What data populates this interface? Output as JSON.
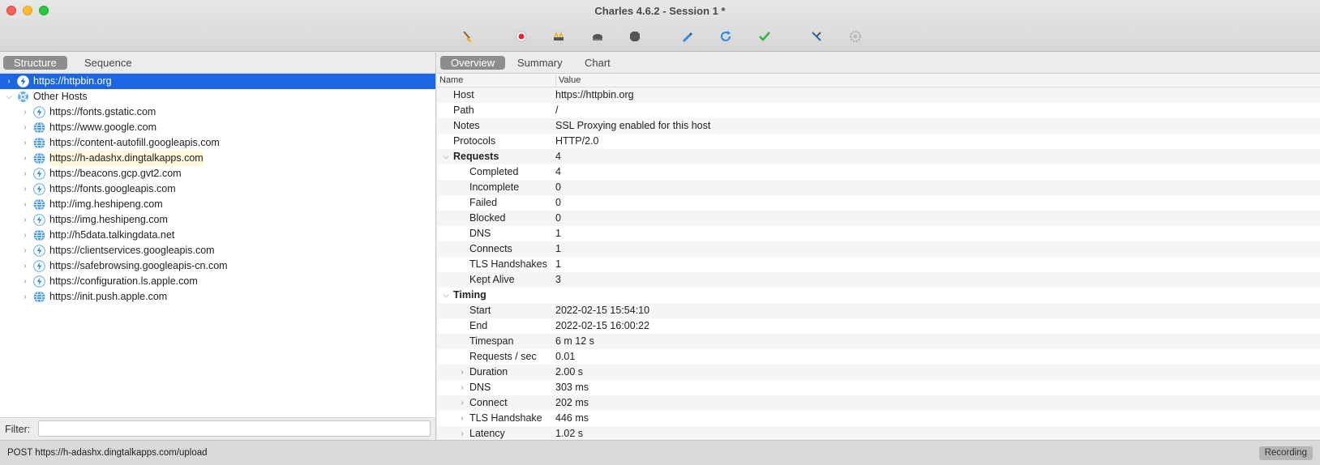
{
  "window": {
    "title": "Charles 4.6.2 - Session 1 *"
  },
  "toolbar": {
    "icons": [
      "broom-icon",
      "record-icon",
      "throttle-icon",
      "turtle-icon",
      "stop-breakpoint-icon",
      "compose-icon",
      "repeat-icon",
      "validate-icon",
      "tools-icon",
      "settings-icon"
    ]
  },
  "left_tabs": [
    {
      "label": "Structure",
      "active": true
    },
    {
      "label": "Sequence",
      "active": false
    }
  ],
  "tree": [
    {
      "label": "https://httpbin.org",
      "level": 0,
      "icon": "ssl-lightning-icon",
      "selected": true,
      "expanded": false
    },
    {
      "label": "Other Hosts",
      "level": 0,
      "icon": "hosts-gear-icon",
      "expanded": true
    },
    {
      "label": "https://fonts.gstatic.com",
      "level": 1,
      "icon": "ssl-lightning-icon"
    },
    {
      "label": "https://www.google.com",
      "level": 1,
      "icon": "globe-icon"
    },
    {
      "label": "https://content-autofill.googleapis.com",
      "level": 1,
      "icon": "globe-icon"
    },
    {
      "label": "https://h-adashx.dingtalkapps.com",
      "level": 1,
      "icon": "globe-icon",
      "highlighted": true
    },
    {
      "label": "https://beacons.gcp.gvt2.com",
      "level": 1,
      "icon": "ssl-lightning-icon"
    },
    {
      "label": "https://fonts.googleapis.com",
      "level": 1,
      "icon": "ssl-lightning-icon"
    },
    {
      "label": "http://img.heshipeng.com",
      "level": 1,
      "icon": "globe-icon"
    },
    {
      "label": "https://img.heshipeng.com",
      "level": 1,
      "icon": "ssl-lightning-icon"
    },
    {
      "label": "http://h5data.talkingdata.net",
      "level": 1,
      "icon": "globe-icon"
    },
    {
      "label": "https://clientservices.googleapis.com",
      "level": 1,
      "icon": "ssl-lightning-icon"
    },
    {
      "label": "https://safebrowsing.googleapis-cn.com",
      "level": 1,
      "icon": "ssl-lightning-icon"
    },
    {
      "label": "https://configuration.ls.apple.com",
      "level": 1,
      "icon": "ssl-lightning-icon"
    },
    {
      "label": "https://init.push.apple.com",
      "level": 1,
      "icon": "globe-icon"
    }
  ],
  "filter": {
    "label": "Filter:",
    "value": ""
  },
  "right_tabs": [
    {
      "label": "Overview",
      "active": true
    },
    {
      "label": "Summary",
      "active": false
    },
    {
      "label": "Chart",
      "active": false
    }
  ],
  "columns": {
    "name": "Name",
    "value": "Value"
  },
  "overview": [
    {
      "name": "Host",
      "value": "https://httpbin.org",
      "level": 0
    },
    {
      "name": "Path",
      "value": "/",
      "level": 0
    },
    {
      "name": "Notes",
      "value": "SSL Proxying enabled for this host",
      "level": 0
    },
    {
      "name": "Protocols",
      "value": "HTTP/2.0",
      "level": 0
    },
    {
      "name": "Requests",
      "value": "4",
      "level": 0,
      "group": true,
      "expanded": true
    },
    {
      "name": "Completed",
      "value": "4",
      "level": 1
    },
    {
      "name": "Incomplete",
      "value": "0",
      "level": 1
    },
    {
      "name": "Failed",
      "value": "0",
      "level": 1
    },
    {
      "name": "Blocked",
      "value": "0",
      "level": 1
    },
    {
      "name": "DNS",
      "value": "1",
      "level": 1
    },
    {
      "name": "Connects",
      "value": "1",
      "level": 1
    },
    {
      "name": "TLS Handshakes",
      "value": "1",
      "level": 1
    },
    {
      "name": "Kept Alive",
      "value": "3",
      "level": 1
    },
    {
      "name": "Timing",
      "value": "",
      "level": 0,
      "group": true,
      "expanded": true
    },
    {
      "name": "Start",
      "value": "2022-02-15 15:54:10",
      "level": 1
    },
    {
      "name": "End",
      "value": "2022-02-15 16:00:22",
      "level": 1
    },
    {
      "name": "Timespan",
      "value": "6 m 12 s",
      "level": 1
    },
    {
      "name": "Requests / sec",
      "value": "0.01",
      "level": 1
    },
    {
      "name": "Duration",
      "value": "2.00 s",
      "level": 1,
      "collapsed": true
    },
    {
      "name": "DNS",
      "value": "303 ms",
      "level": 1,
      "collapsed": true
    },
    {
      "name": "Connect",
      "value": "202 ms",
      "level": 1,
      "collapsed": true
    },
    {
      "name": "TLS Handshake",
      "value": "446 ms",
      "level": 1,
      "collapsed": true
    },
    {
      "name": "Latency",
      "value": "1.02 s",
      "level": 1,
      "collapsed": true
    }
  ],
  "status": {
    "text": "POST https://h-adashx.dingtalkapps.com/upload",
    "recording_label": "Recording"
  },
  "colors": {
    "selection": "#1c66e3",
    "accent_blue": "#2b8ae6"
  }
}
